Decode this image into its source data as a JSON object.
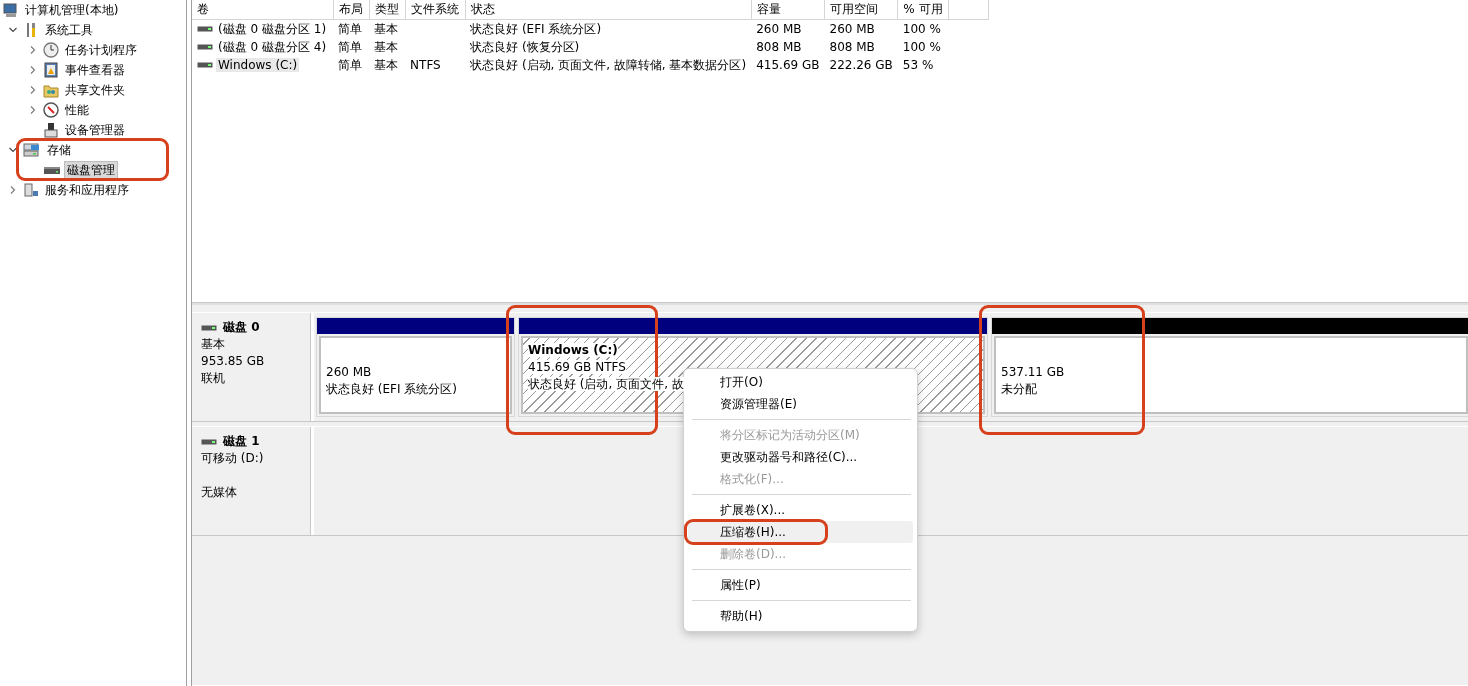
{
  "tree": {
    "label": "计算机管理(本地)",
    "kind": "computer",
    "selected": false,
    "children": [
      {
        "label": "系统工具",
        "kind": "tools",
        "expanded": true,
        "selected": false,
        "children": [
          {
            "label": "任务计划程序",
            "kind": "clock",
            "expanded": false,
            "selected": false
          },
          {
            "label": "事件查看器",
            "kind": "event",
            "expanded": false,
            "selected": false
          },
          {
            "label": "共享文件夹",
            "kind": "share",
            "expanded": false,
            "selected": false
          },
          {
            "label": "性能",
            "kind": "perf",
            "expanded": false,
            "selected": false
          },
          {
            "label": "设备管理器",
            "kind": "device",
            "selected": false
          }
        ]
      },
      {
        "label": "存储",
        "kind": "storage",
        "expanded": true,
        "selected": false,
        "annotated": true,
        "children": [
          {
            "label": "磁盘管理",
            "kind": "disk",
            "selected": true
          }
        ]
      },
      {
        "label": "服务和应用程序",
        "kind": "services",
        "expanded": false,
        "selected": false
      }
    ]
  },
  "volume_table": {
    "columns": [
      "卷",
      "布局",
      "类型",
      "文件系统",
      "状态",
      "容量",
      "可用空间",
      "% 可用"
    ],
    "rows": [
      {
        "selected": false,
        "cells": [
          "(磁盘 0 磁盘分区 1)",
          "简单",
          "基本",
          "",
          "状态良好 (EFI 系统分区)",
          "260 MB",
          "260 MB",
          "100 %"
        ]
      },
      {
        "selected": false,
        "cells": [
          "(磁盘 0 磁盘分区 4)",
          "简单",
          "基本",
          "",
          "状态良好 (恢复分区)",
          "808 MB",
          "808 MB",
          "100 %"
        ]
      },
      {
        "selected": true,
        "cells": [
          "Windows (C:)",
          "简单",
          "基本",
          "NTFS",
          "状态良好 (启动, 页面文件, 故障转储, 基本数据分区)",
          "415.69 GB",
          "222.26 GB",
          "53 %"
        ]
      }
    ]
  },
  "disks": [
    {
      "name": "磁盘 0",
      "type": "基本",
      "size": "953.85 GB",
      "state": "联机",
      "partitions": [
        {
          "kind": "primary",
          "selected": false,
          "size": "260 MB",
          "status": "状态良好 (EFI 系统分区)"
        },
        {
          "kind": "primary",
          "selected": true,
          "annotated": true,
          "title": "Windows  (C:)",
          "size": "415.69 GB NTFS",
          "status": "状态良好 (启动, 页面文件, 故"
        },
        {
          "kind": "unallocated",
          "selected": false,
          "annotated": true,
          "size": "537.11 GB",
          "status": "未分配"
        }
      ]
    },
    {
      "name": "磁盘 1",
      "type": "可移动 (D:)",
      "state": "无媒体"
    }
  ],
  "context_menu": {
    "items": [
      {
        "kind": "item",
        "label": "打开(O)",
        "disabled": false,
        "selected": false
      },
      {
        "kind": "item",
        "label": "资源管理器(E)",
        "disabled": false,
        "selected": false
      },
      {
        "kind": "separator"
      },
      {
        "kind": "item",
        "label": "将分区标记为活动分区(M)",
        "disabled": true,
        "selected": false
      },
      {
        "kind": "item",
        "label": "更改驱动器号和路径(C)...",
        "disabled": false,
        "selected": false
      },
      {
        "kind": "item",
        "label": "格式化(F)...",
        "disabled": true,
        "selected": false
      },
      {
        "kind": "separator"
      },
      {
        "kind": "item",
        "label": "扩展卷(X)...",
        "disabled": false,
        "selected": false
      },
      {
        "kind": "item",
        "label": "压缩卷(H)...",
        "disabled": false,
        "selected": true,
        "annotated": true
      },
      {
        "kind": "item",
        "label": "删除卷(D)...",
        "disabled": true,
        "selected": false
      },
      {
        "kind": "separator"
      },
      {
        "kind": "item",
        "label": "属性(P)",
        "disabled": false,
        "selected": false
      },
      {
        "kind": "separator"
      },
      {
        "kind": "item",
        "label": "帮助(H)",
        "disabled": false,
        "selected": false
      }
    ]
  }
}
